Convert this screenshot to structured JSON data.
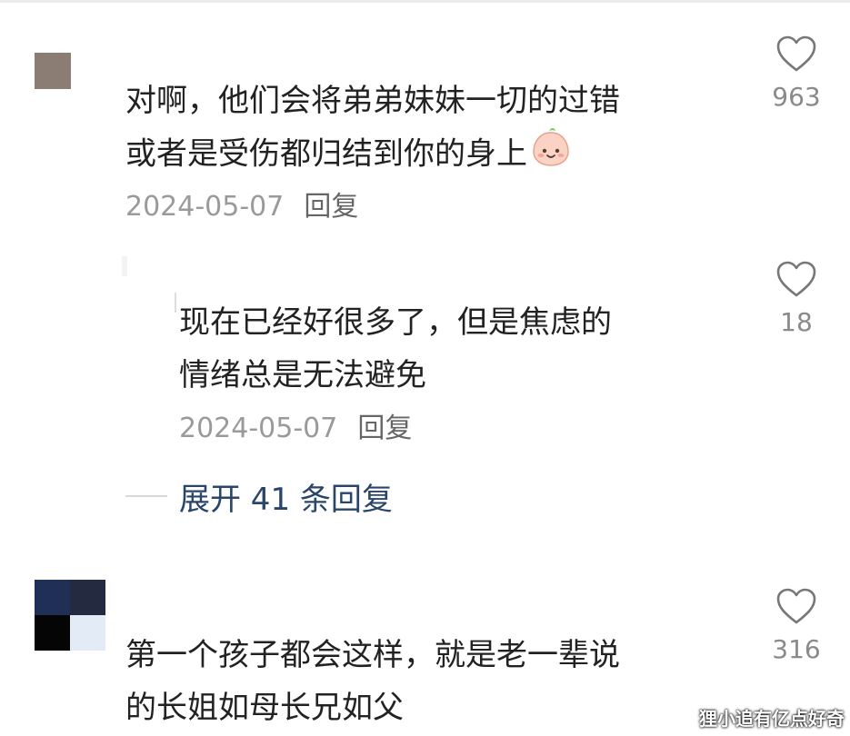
{
  "comments": [
    {
      "text_line1": "对啊，他们会将弟弟妹妹一切的过错",
      "text_line2": "或者是受伤都归结到你的身上",
      "date": "2024-05-07",
      "reply_label": "回复",
      "likes": "963",
      "emoji": "blush-face-emoji"
    },
    {
      "text_line1": "现在已经好很多了，但是焦虑的",
      "text_line2": "情绪总是无法避免",
      "date": "2024-05-07",
      "reply_label": "回复",
      "likes": "18"
    },
    {
      "text_line1": "第一个孩子都会这样，就是老一辈说",
      "text_line2": "的长姐如母长兄如父",
      "likes": "316"
    }
  ],
  "expand_replies_label": "展开 41 条回复",
  "watermark": "狸小追有亿点好奇",
  "icons": {
    "like": "heart-outline-icon"
  },
  "colors": {
    "text": "#222222",
    "meta": "#9a9a9a",
    "link": "#29456a",
    "icon": "#777777"
  }
}
